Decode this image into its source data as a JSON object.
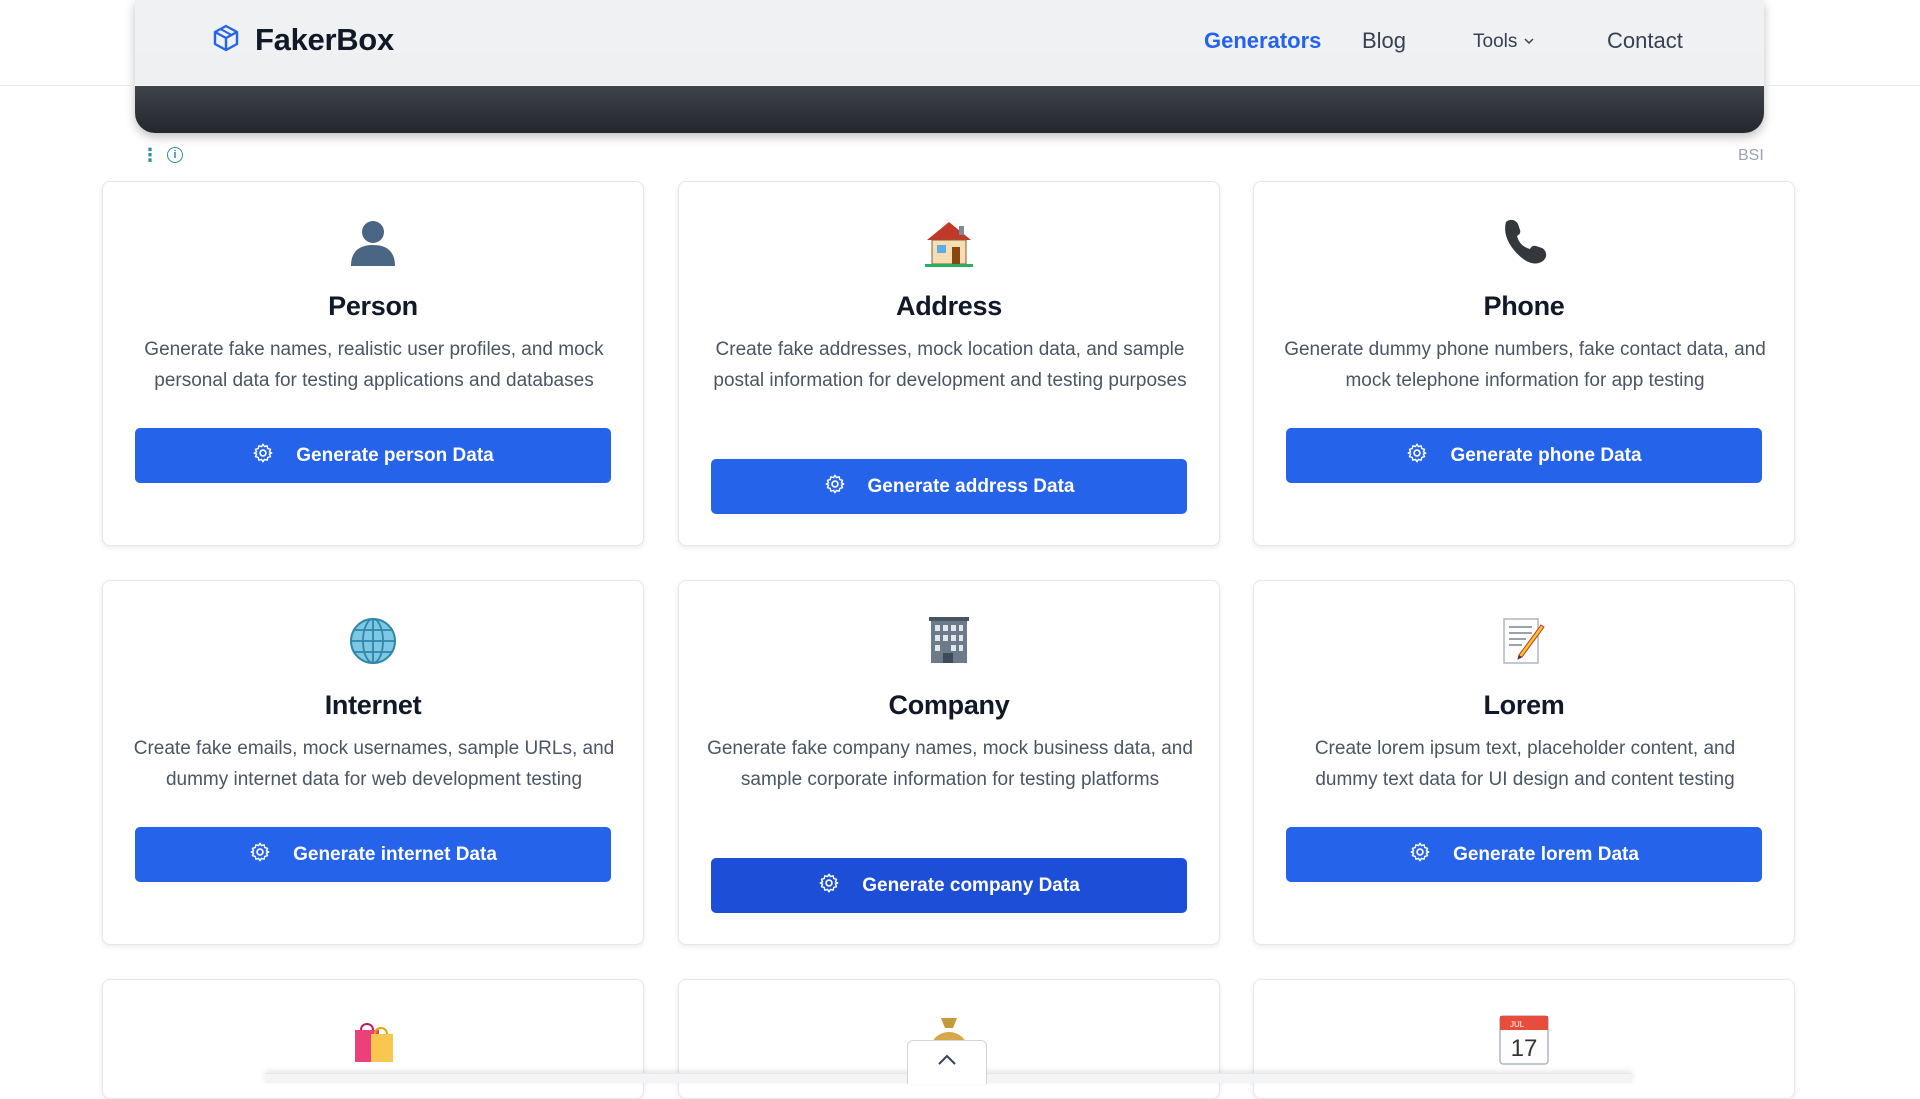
{
  "header": {
    "brand": "FakerBox",
    "nav": {
      "generators": "Generators",
      "blog": "Blog",
      "tools": "Tools",
      "contact": "Contact"
    },
    "accent_color": "#2563eb"
  },
  "ad": {
    "label": "BSI",
    "info_icon": "info-icon"
  },
  "cards": [
    {
      "icon": "person-silhouette-icon",
      "title": "Person",
      "description": "Generate fake names, realistic user profiles, and mock personal data for testing applications and databases",
      "button": "Generate person Data"
    },
    {
      "icon": "house-icon",
      "title": "Address",
      "description": "Create fake addresses, mock location data, and sample postal information for development and testing purposes",
      "button": "Generate address Data"
    },
    {
      "icon": "telephone-receiver-icon",
      "title": "Phone",
      "description": "Generate dummy phone numbers, fake contact data, and mock telephone information for app testing",
      "button": "Generate phone Data"
    },
    {
      "icon": "globe-icon",
      "title": "Internet",
      "description": "Create fake emails, mock usernames, sample URLs, and dummy internet data for web development testing",
      "button": "Generate internet Data"
    },
    {
      "icon": "office-building-icon",
      "title": "Company",
      "description": "Generate fake company names, mock business data, and sample corporate information for testing platforms",
      "button": "Generate company Data"
    },
    {
      "icon": "memo-pencil-icon",
      "title": "Lorem",
      "description": "Create lorem ipsum text, placeholder content, and dummy text data for UI design and content testing",
      "button": "Generate lorem Data"
    }
  ],
  "partial_cards": [
    {
      "icon": "shopping-bags-icon"
    },
    {
      "icon": "money-bag-icon"
    },
    {
      "icon": "calendar-icon",
      "month": "JUL",
      "day": "17"
    }
  ]
}
